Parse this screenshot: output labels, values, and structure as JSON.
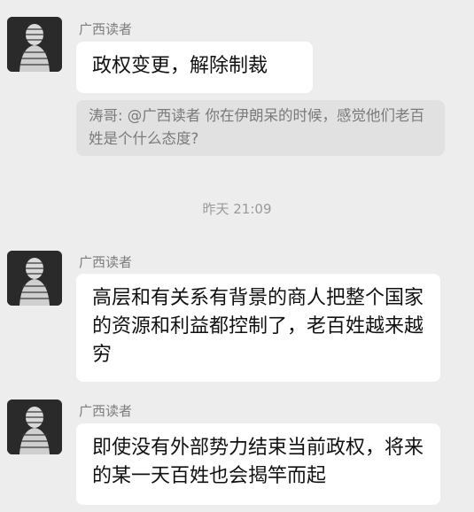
{
  "messages": [
    {
      "sender": "广西读者",
      "text": "政权变更，解除制裁"
    },
    {
      "sender": "广西读者",
      "text": "高层和有关系有背景的商人把整个国家的资源和利益都控制了，老百姓越来越穷"
    },
    {
      "sender": "广西读者",
      "text": "即使没有外部势力结束当前政权，将来的某一天百姓也会揭竿而起"
    }
  ],
  "quote": {
    "text": "涛哥: @广西读者 你在伊朗呆的时候，感觉他们老百姓是个什么态度?"
  },
  "timestamp": "昨天 21:09",
  "colors": {
    "background": "#ededed",
    "bubble": "#ffffff",
    "quote_background": "#e1e1e1",
    "sender_text": "#7d7d7d"
  },
  "icons": {
    "avatar": "statue-avatar-icon"
  }
}
